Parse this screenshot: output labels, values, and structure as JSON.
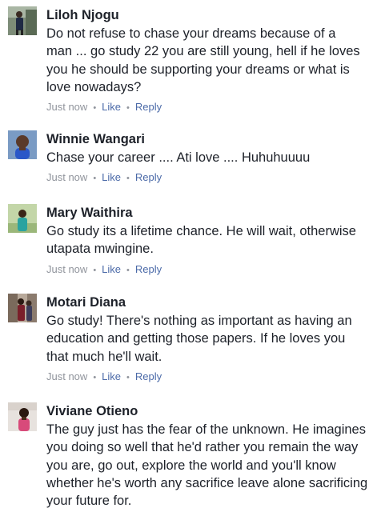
{
  "comments": [
    {
      "author": "Liloh Njogu",
      "lines": [
        "Do not refuse to chase your dreams because of a",
        "man ... go study 22 you are still young, hell if he loves",
        "you he should be supporting your dreams or what is",
        "love nowadays?"
      ],
      "time": "Just now",
      "like": "Like",
      "reply": "Reply"
    },
    {
      "author": "Winnie Wangari",
      "lines": [
        "Chase your career .... Ati love .... Huhuhuuuu"
      ],
      "time": "Just now",
      "like": "Like",
      "reply": "Reply"
    },
    {
      "author": "Mary Waithira",
      "lines": [
        "Go study its a lifetime chance. He will wait, otherwise",
        "utapata mwingine."
      ],
      "time": "Just now",
      "like": "Like",
      "reply": "Reply"
    },
    {
      "author": "Motari Diana",
      "lines": [
        "Go study! There's nothing as important as having an",
        "education and getting those papers. If he loves you",
        "that much he'll wait."
      ],
      "time": "Just now",
      "like": "Like",
      "reply": "Reply"
    },
    {
      "author": "Viviane Otieno",
      "lines": [
        "The guy just has the fear of the unknown. He imagines",
        "you doing so well that he'd rather you remain the way",
        "you are, go out, explore the world and you'll know",
        "whether he's worth any sacrifice leave alone sacrificing",
        "your future for."
      ]
    }
  ],
  "separator": "•",
  "colors": {
    "name": "#1d2129",
    "text": "#1d2129",
    "meta": "#90949c",
    "action": "#4b6aa8"
  }
}
